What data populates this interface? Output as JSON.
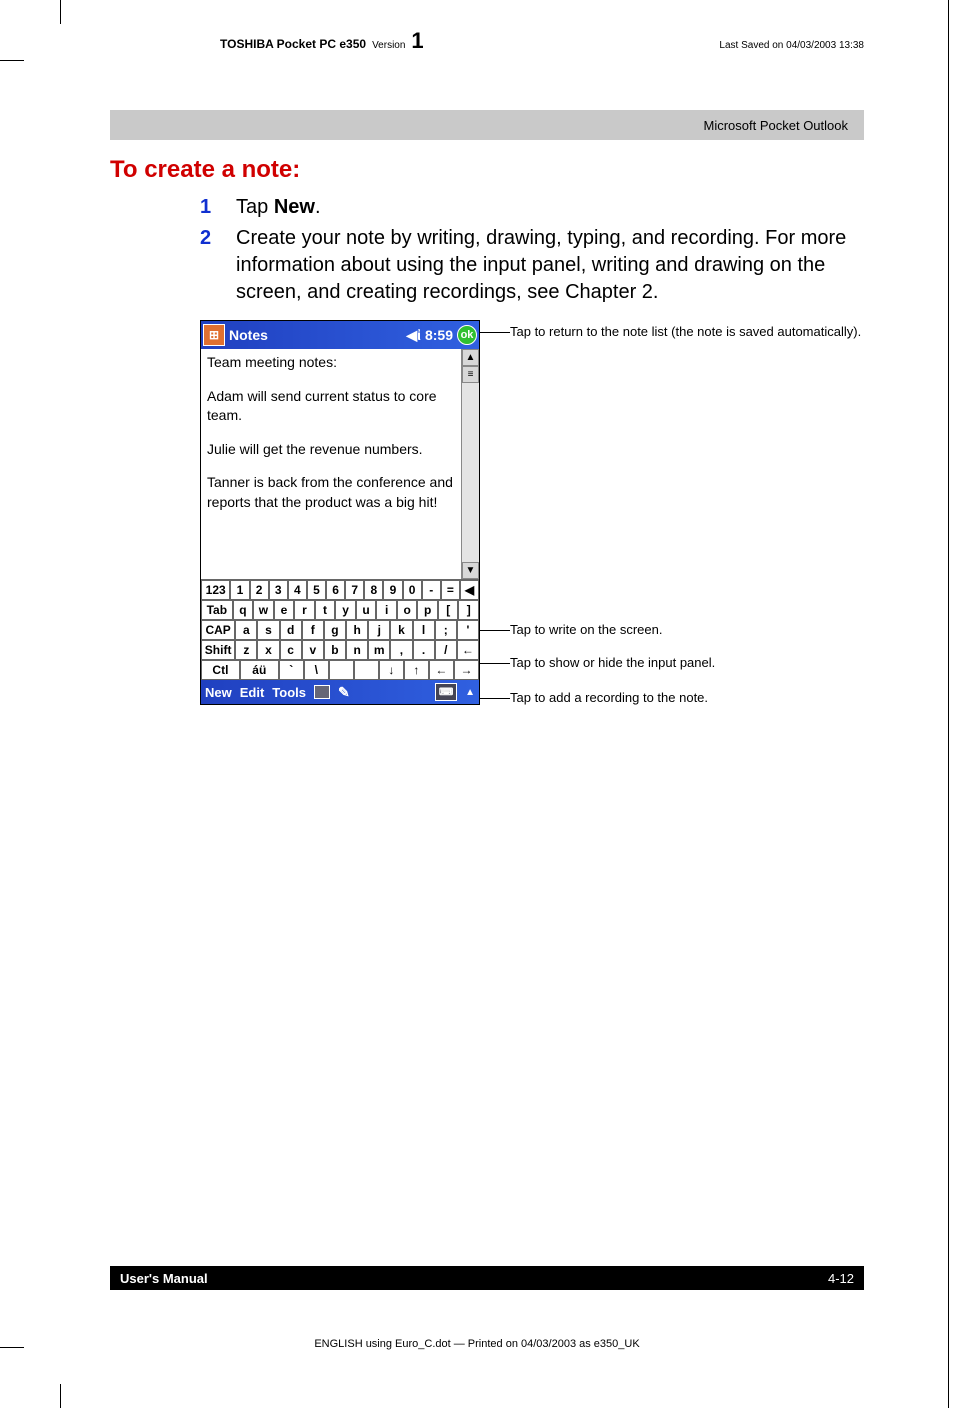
{
  "header": {
    "product": "TOSHIBA Pocket PC e350",
    "version_label": "Version",
    "version_num": "1",
    "saved": "Last Saved on 04/03/2003 13:38"
  },
  "chapter_bar": "Microsoft Pocket Outlook",
  "section_title": "To create a note:",
  "steps": [
    {
      "num": "1",
      "text_before": "Tap ",
      "bold": "New",
      "text_after": "."
    },
    {
      "num": "2",
      "text_before": "Create your note by writing, drawing, typing, and recording. For more information about using the input panel, writing and drawing on the screen, and creating recordings, see Chapter 2.",
      "bold": "",
      "text_after": ""
    }
  ],
  "device": {
    "title": "Notes",
    "clock": "8:59",
    "ok": "ok",
    "note_lines": [
      "Team meeting notes:",
      "Adam will send current status to core team.",
      "Julie will get the revenue numbers.",
      "Tanner is back from the conference and reports that the product was a big hit!"
    ],
    "sip_rows": [
      [
        "123",
        "1",
        "2",
        "3",
        "4",
        "5",
        "6",
        "7",
        "8",
        "9",
        "0",
        "-",
        "=",
        "◀"
      ],
      [
        "Tab",
        "q",
        "w",
        "e",
        "r",
        "t",
        "y",
        "u",
        "i",
        "o",
        "p",
        "[",
        "]"
      ],
      [
        "CAP",
        "a",
        "s",
        "d",
        "f",
        "g",
        "h",
        "j",
        "k",
        "l",
        ";",
        "'"
      ],
      [
        "Shift",
        "z",
        "x",
        "c",
        "v",
        "b",
        "n",
        "m",
        ",",
        ".",
        "/",
        "←"
      ],
      [
        "Ctl",
        "áü",
        "`",
        "\\",
        " ",
        " ",
        "↓",
        "↑",
        "←",
        "→"
      ]
    ],
    "cmdbar": {
      "new": "New",
      "edit": "Edit",
      "tools": "Tools"
    }
  },
  "annotations": {
    "a1": "Tap to return to the note list (the note is saved automatically).",
    "a2": "Tap to write on the screen.",
    "a3": "Tap to show or hide the input panel.",
    "a4": "Tap to add a recording to the note."
  },
  "footer": {
    "left": "User's Manual",
    "right": "4-12"
  },
  "print_info": "ENGLISH using  Euro_C.dot — Printed on 04/03/2003 as e350_UK"
}
